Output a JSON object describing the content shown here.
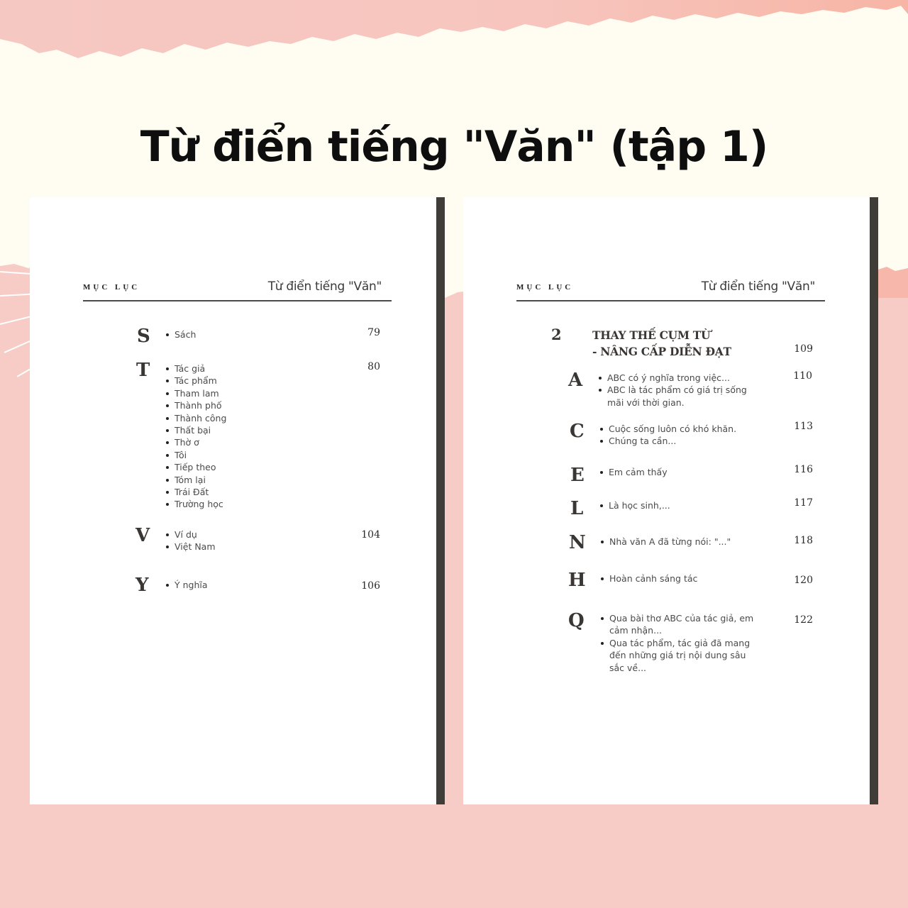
{
  "title": "Từ điển tiếng \"Văn\" (tập 1)",
  "colors": {
    "background_pink": "#f7ccc6",
    "background_cream": "#fffdf2",
    "page": "#ffffff",
    "spine": "#403c38",
    "text_dark": "#0e0e0e"
  },
  "left_page": {
    "header_small": "MỤC LỤC",
    "header_title": "Từ điển tiếng \"Văn\"",
    "entries": [
      {
        "letter": "S",
        "page": "79",
        "items": [
          "Sách"
        ]
      },
      {
        "letter": "T",
        "page": "80",
        "items": [
          "Tác giả",
          "Tác phẩm",
          "Tham lam",
          "Thành phố",
          "Thành công",
          "Thất bại",
          "Thờ ơ",
          "Tôi",
          "Tiếp theo",
          "Tóm lại",
          "Trái Đất",
          "Trường học"
        ]
      },
      {
        "letter": "V",
        "page": "104",
        "items": [
          "Ví dụ",
          "Việt Nam"
        ]
      },
      {
        "letter": "Y",
        "page": "106",
        "items": [
          "Ý nghĩa"
        ]
      }
    ]
  },
  "right_page": {
    "header_small": "MỤC LỤC",
    "header_title": "Từ điển tiếng \"Văn\"",
    "section": {
      "number": "2",
      "title_line1": "THAY THẾ CỤM TỪ",
      "title_line2": "- NÂNG CẤP DIỄN ĐẠT",
      "page": "109"
    },
    "entries": [
      {
        "letter": "A",
        "page": "110",
        "items": [
          "ABC có ý nghĩa trong việc...",
          "ABC là tác phẩm có giá trị sống mãi với thời gian."
        ]
      },
      {
        "letter": "C",
        "page": "113",
        "items": [
          "Cuộc sống luôn có khó khăn.",
          "Chúng ta cần..."
        ]
      },
      {
        "letter": "E",
        "page": "116",
        "items": [
          "Em cảm thấy"
        ]
      },
      {
        "letter": "L",
        "page": "117",
        "items": [
          "Là học sinh,..."
        ]
      },
      {
        "letter": "N",
        "page": "118",
        "items": [
          "Nhà văn A đã từng nói: \"...\""
        ]
      },
      {
        "letter": "H",
        "page": "120",
        "items": [
          "Hoàn cảnh sáng tác"
        ]
      },
      {
        "letter": "Q",
        "page": "122",
        "items": [
          "Qua bài thơ ABC của tác giả, em cảm nhận...",
          "Qua tác phẩm, tác giả đã mang đến những giá trị nội dung sâu sắc về..."
        ]
      }
    ]
  }
}
